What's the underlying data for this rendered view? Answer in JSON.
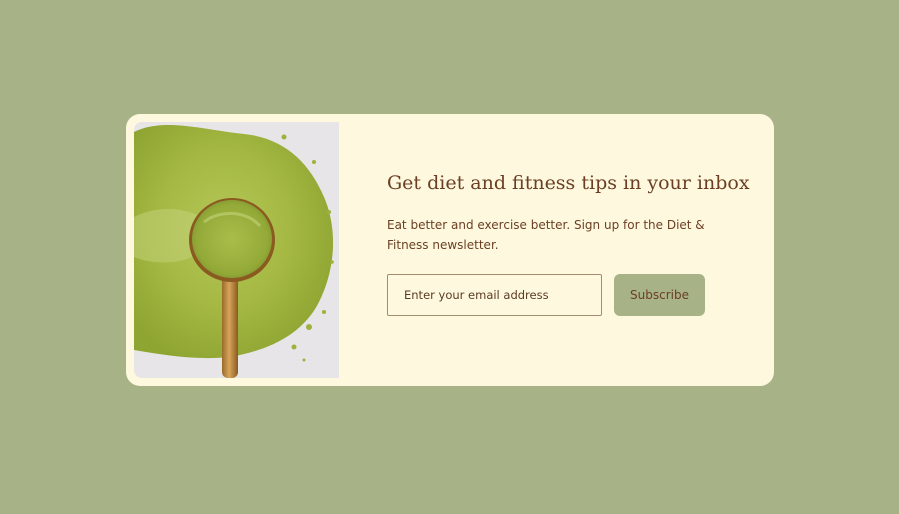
{
  "colors": {
    "page_background": "#a8b287",
    "card_background": "#fef9de",
    "text_brown": "#6b3e23",
    "button_background": "#a8b287",
    "input_border": "#a58c6e"
  },
  "hero": {
    "icon": "matcha-powder-spoon-image"
  },
  "newsletter": {
    "title": "Get diet and fitness tips in your inbox",
    "description": "Eat better and exercise better. Sign up for the Diet & Fitness newsletter.",
    "email_placeholder": "Enter your email address",
    "email_value": "",
    "subscribe_label": "Subscribe"
  }
}
